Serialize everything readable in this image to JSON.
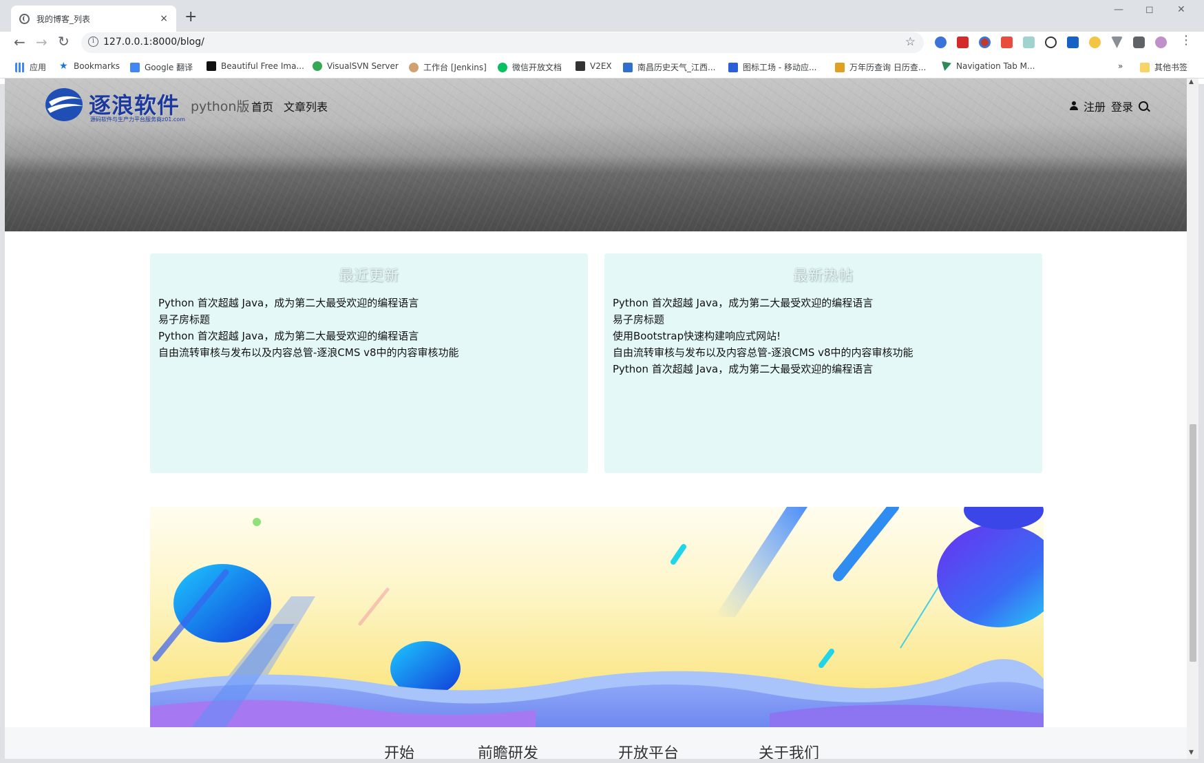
{
  "browser": {
    "tab_title": "我的博客_列表",
    "tab_close": "×",
    "new_tab": "+",
    "url": "127.0.0.1:8000/blog/",
    "info_glyph": "i",
    "bookmarks": [
      {
        "label": "应用",
        "color": "#4285f4"
      },
      {
        "label": "Bookmarks",
        "color": "#1a73e8"
      },
      {
        "label": "Google 翻译",
        "color": "#4285f4"
      },
      {
        "label": "Beautiful Free Ima...",
        "color": "#111111"
      },
      {
        "label": "VisualSVN Server",
        "color": "#34a853"
      },
      {
        "label": "工作台 [Jenkins]",
        "color": "#d0a070"
      },
      {
        "label": "微信开放文档",
        "color": "#07c160"
      },
      {
        "label": "V2EX",
        "color": "#333333"
      },
      {
        "label": "南昌历史天气_江西...",
        "color": "#2f6fcf"
      },
      {
        "label": "图标工场 - 移动应...",
        "color": "#2b5fd9"
      },
      {
        "label": "万年历查询 日历查...",
        "color": "#e0a020"
      },
      {
        "label": "Navigation Tab M...",
        "color": "#2e8b57"
      }
    ],
    "more_bookmarks": "»",
    "other_bookmarks": "其他书签"
  },
  "site": {
    "brand": "逐浪软件",
    "brand_sub": "源码软件与生产力平台服务商z01.com",
    "version": "python版",
    "nav": [
      "首页",
      "文章列表"
    ],
    "register": "注册",
    "login": "登录"
  },
  "recent": {
    "title": "最近更新",
    "items": [
      "Python 首次超越 Java，成为第二大最受欢迎的编程语言",
      "易子房标题",
      "Python 首次超越 Java，成为第二大最受欢迎的编程语言",
      "自由流转审核与发布以及内容总管-逐浪CMS v8中的内容审核功能"
    ]
  },
  "hot": {
    "title": "最新热帖",
    "items": [
      "Python 首次超越 Java，成为第二大最受欢迎的编程语言",
      "易子房标题",
      "使用Bootstrap快速构建响应式网站!",
      "自由流转审核与发布以及内容总管-逐浪CMS v8中的内容审核功能",
      "Python 首次超越 Java，成为第二大最受欢迎的编程语言"
    ]
  },
  "footer": {
    "links": [
      "开始",
      "前瞻研发",
      "开放平台",
      "关于我们"
    ]
  },
  "colors": {
    "accent": "#1c3a9e",
    "panel_bg": "#e4f8f7"
  }
}
